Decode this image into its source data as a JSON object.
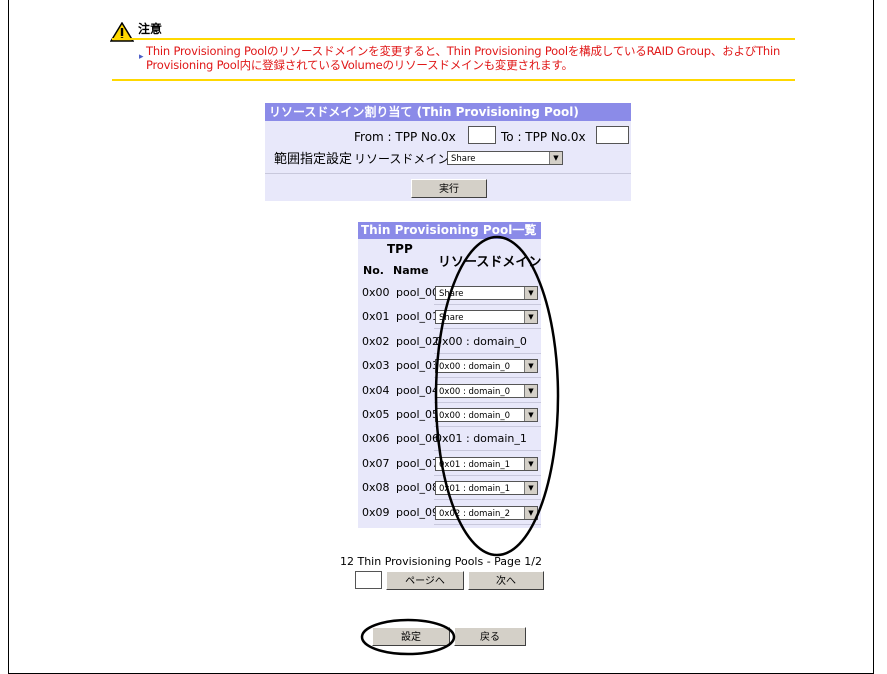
{
  "warning": {
    "title": "注意",
    "icon": "warning-icon",
    "text": "Thin Provisioning Poolのリソースドメインを変更すると、Thin Provisioning Poolを構成しているRAID Group、およびThin Provisioning Pool内に登録されているVolumeのリソースドメインも変更されます。"
  },
  "assign": {
    "header": "リソースドメイン割り当て (Thin Provisioning Pool)",
    "range_label": "範囲指定設定",
    "from_label": "From : TPP No.0x",
    "to_label": "To : TPP No.0x",
    "from_value": "",
    "to_value": "",
    "domain_label": "リソースドメイン :",
    "domain_value": "Share",
    "execute": "実行"
  },
  "pool_list": {
    "header": "Thin Provisioning Pool一覧",
    "col_tpp": "TPP",
    "col_no": "No.",
    "col_name": "Name",
    "col_domain": "リソースドメイン",
    "rows": [
      {
        "no": "0x00",
        "name": "pool_00",
        "domain": "Share",
        "editable": true
      },
      {
        "no": "0x01",
        "name": "pool_01",
        "domain": "Share",
        "editable": true
      },
      {
        "no": "0x02",
        "name": "pool_02",
        "domain": "0x00 : domain_0",
        "editable": false
      },
      {
        "no": "0x03",
        "name": "pool_03",
        "domain": "0x00 : domain_0",
        "editable": true
      },
      {
        "no": "0x04",
        "name": "pool_04",
        "domain": "0x00 : domain_0",
        "editable": true
      },
      {
        "no": "0x05",
        "name": "pool_05",
        "domain": "0x00 : domain_0",
        "editable": true
      },
      {
        "no": "0x06",
        "name": "pool_06",
        "domain": "0x01 : domain_1",
        "editable": false
      },
      {
        "no": "0x07",
        "name": "pool_07",
        "domain": "0x01 : domain_1",
        "editable": true
      },
      {
        "no": "0x08",
        "name": "pool_08",
        "domain": "0x01 : domain_1",
        "editable": true
      },
      {
        "no": "0x09",
        "name": "pool_09",
        "domain": "0x02 : domain_2",
        "editable": true
      }
    ],
    "summary": "12 Thin Provisioning Pools - Page 1/2",
    "page_value": "",
    "goto_page": "ページへ",
    "next": "次へ"
  },
  "footer": {
    "set": "設定",
    "back": "戻る"
  }
}
